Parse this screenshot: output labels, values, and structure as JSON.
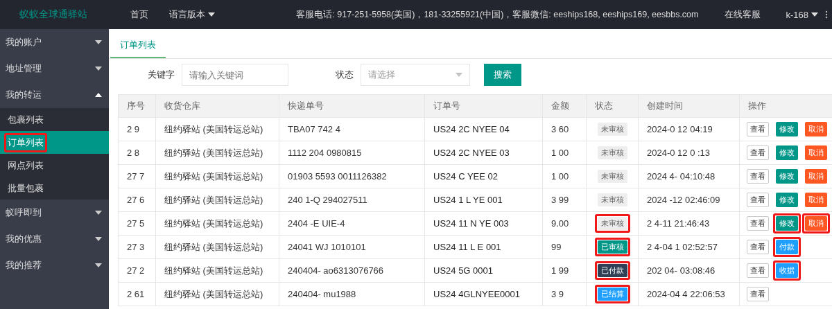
{
  "header": {
    "logo": "蚁蚁全球通驿站",
    "nav": [
      {
        "label": "首页",
        "dropdown": false
      },
      {
        "label": "语言版本",
        "dropdown": true
      }
    ],
    "contact": "客服电话: 917-251-5958(美国)，181-33255921(中国)，客服微信: eeships168, eeships169, eesbbs.com",
    "service": "在线客服",
    "user": "k-168"
  },
  "sidebar": {
    "items": [
      {
        "label": "我的账户",
        "expanded": false
      },
      {
        "label": "地址管理",
        "expanded": false
      },
      {
        "label": "我的转运",
        "expanded": true,
        "children": [
          {
            "label": "包裹列表",
            "selected": false,
            "highlighted": false
          },
          {
            "label": "订单列表",
            "selected": true,
            "highlighted": true
          },
          {
            "label": "网点列表",
            "selected": false,
            "highlighted": false
          },
          {
            "label": "批量包裹",
            "selected": false,
            "highlighted": false
          }
        ]
      },
      {
        "label": "蚁呼即到",
        "expanded": false
      },
      {
        "label": "我的优惠",
        "expanded": false
      },
      {
        "label": "我的推荐",
        "expanded": false
      }
    ]
  },
  "tabs": [
    {
      "label": "订单列表",
      "selected": true
    }
  ],
  "filters": {
    "keyword_label": "关键字",
    "keyword_placeholder": "请输入关键词",
    "status_label": "状态",
    "status_placeholder": "请选择",
    "search_button": "搜索"
  },
  "table": {
    "columns": [
      "序号",
      "收货仓库",
      "快递单号",
      "订单号",
      "金额",
      "状态",
      "创建时间",
      "操作"
    ],
    "rows": [
      {
        "no": "2 9",
        "warehouse": "纽约驿站 (美国转运总站)",
        "tracking": "TBA07 742 4",
        "order": "US24 2C NYEE 04",
        "amount": "3 60",
        "status": {
          "label": "未审核",
          "kind": "pending",
          "highlighted": false
        },
        "time": "2024-0 12 04:19",
        "actions": [
          {
            "label": "查看",
            "kind": "view",
            "highlighted": false
          },
          {
            "label": "修改",
            "kind": "edit",
            "highlighted": false
          },
          {
            "label": "取消",
            "kind": "cancel",
            "highlighted": false
          }
        ]
      },
      {
        "no": "2 8",
        "warehouse": "纽约驿站 (美国转运总站)",
        "tracking": "1112 204 0980815",
        "order": "US24 2C NYEE 03",
        "amount": "1 00",
        "status": {
          "label": "未审核",
          "kind": "pending",
          "highlighted": false
        },
        "time": "2024-0 12 0 :13",
        "actions": [
          {
            "label": "查看",
            "kind": "view",
            "highlighted": false
          },
          {
            "label": "修改",
            "kind": "edit",
            "highlighted": false
          },
          {
            "label": "取消",
            "kind": "cancel",
            "highlighted": false
          }
        ]
      },
      {
        "no": "27 7",
        "warehouse": "纽约驿站 (美国转运总站)",
        "tracking": "01903 5593 0011126382",
        "order": "US24 C YEE 02",
        "amount": "1 00",
        "status": {
          "label": "未审核",
          "kind": "pending",
          "highlighted": false
        },
        "time": "2024 4- 04:10:48",
        "actions": [
          {
            "label": "查看",
            "kind": "view",
            "highlighted": false
          },
          {
            "label": "修改",
            "kind": "edit",
            "highlighted": false
          },
          {
            "label": "取消",
            "kind": "cancel",
            "highlighted": false
          }
        ]
      },
      {
        "no": "27 6",
        "warehouse": "纽约驿站 (美国转运总站)",
        "tracking": "240 1-Q 294027511",
        "order": "US24 1 L YE 001",
        "amount": "3 99",
        "status": {
          "label": "未审核",
          "kind": "pending",
          "highlighted": false
        },
        "time": "2024 -12 02:46:09",
        "actions": [
          {
            "label": "查看",
            "kind": "view",
            "highlighted": false
          },
          {
            "label": "修改",
            "kind": "edit",
            "highlighted": false
          },
          {
            "label": "取消",
            "kind": "cancel",
            "highlighted": false
          }
        ]
      },
      {
        "no": "27 5",
        "warehouse": "纽约驿站 (美国转运总站)",
        "tracking": "2404 -E UIE-4",
        "order": "US24 11 N YE 003",
        "amount": "9.00",
        "status": {
          "label": "未审核",
          "kind": "pending",
          "highlighted": true
        },
        "time": "2 4-11 21:46:43",
        "actions": [
          {
            "label": "查看",
            "kind": "view",
            "highlighted": false
          },
          {
            "label": "修改",
            "kind": "edit",
            "highlighted": true
          },
          {
            "label": "取消",
            "kind": "cancel",
            "highlighted": true
          }
        ]
      },
      {
        "no": "27 3",
        "warehouse": "纽约驿站 (美国转运总站)",
        "tracking": "24041 WJ 1010101",
        "order": "US24 11 L E 001",
        "amount": "99",
        "status": {
          "label": "已审核",
          "kind": "approved",
          "highlighted": true
        },
        "time": "2 4-04 1 02:52:57",
        "actions": [
          {
            "label": "查看",
            "kind": "view",
            "highlighted": false
          },
          {
            "label": "付款",
            "kind": "pay",
            "highlighted": true
          }
        ]
      },
      {
        "no": "27 2",
        "warehouse": "纽约驿站 (美国转运总站)",
        "tracking": "240404- ao6313076766",
        "order": "US24 5G 0001",
        "amount": "1 99",
        "status": {
          "label": "已付款",
          "kind": "paid",
          "highlighted": true
        },
        "time": "202 04- 03:08:46",
        "actions": [
          {
            "label": "查看",
            "kind": "view",
            "highlighted": false
          },
          {
            "label": "收据",
            "kind": "receipt",
            "highlighted": true
          }
        ]
      },
      {
        "no": "2 61",
        "warehouse": "纽约驿站 (美国转运总站)",
        "tracking": "240404- mu1988",
        "order": "US24 4GLNYEE0001",
        "amount": "3 9",
        "status": {
          "label": "已结算",
          "kind": "settled",
          "highlighted": true
        },
        "time": "2024-04 4 22:06:53",
        "actions": [
          {
            "label": "查看",
            "kind": "view",
            "highlighted": false
          }
        ]
      }
    ]
  }
}
